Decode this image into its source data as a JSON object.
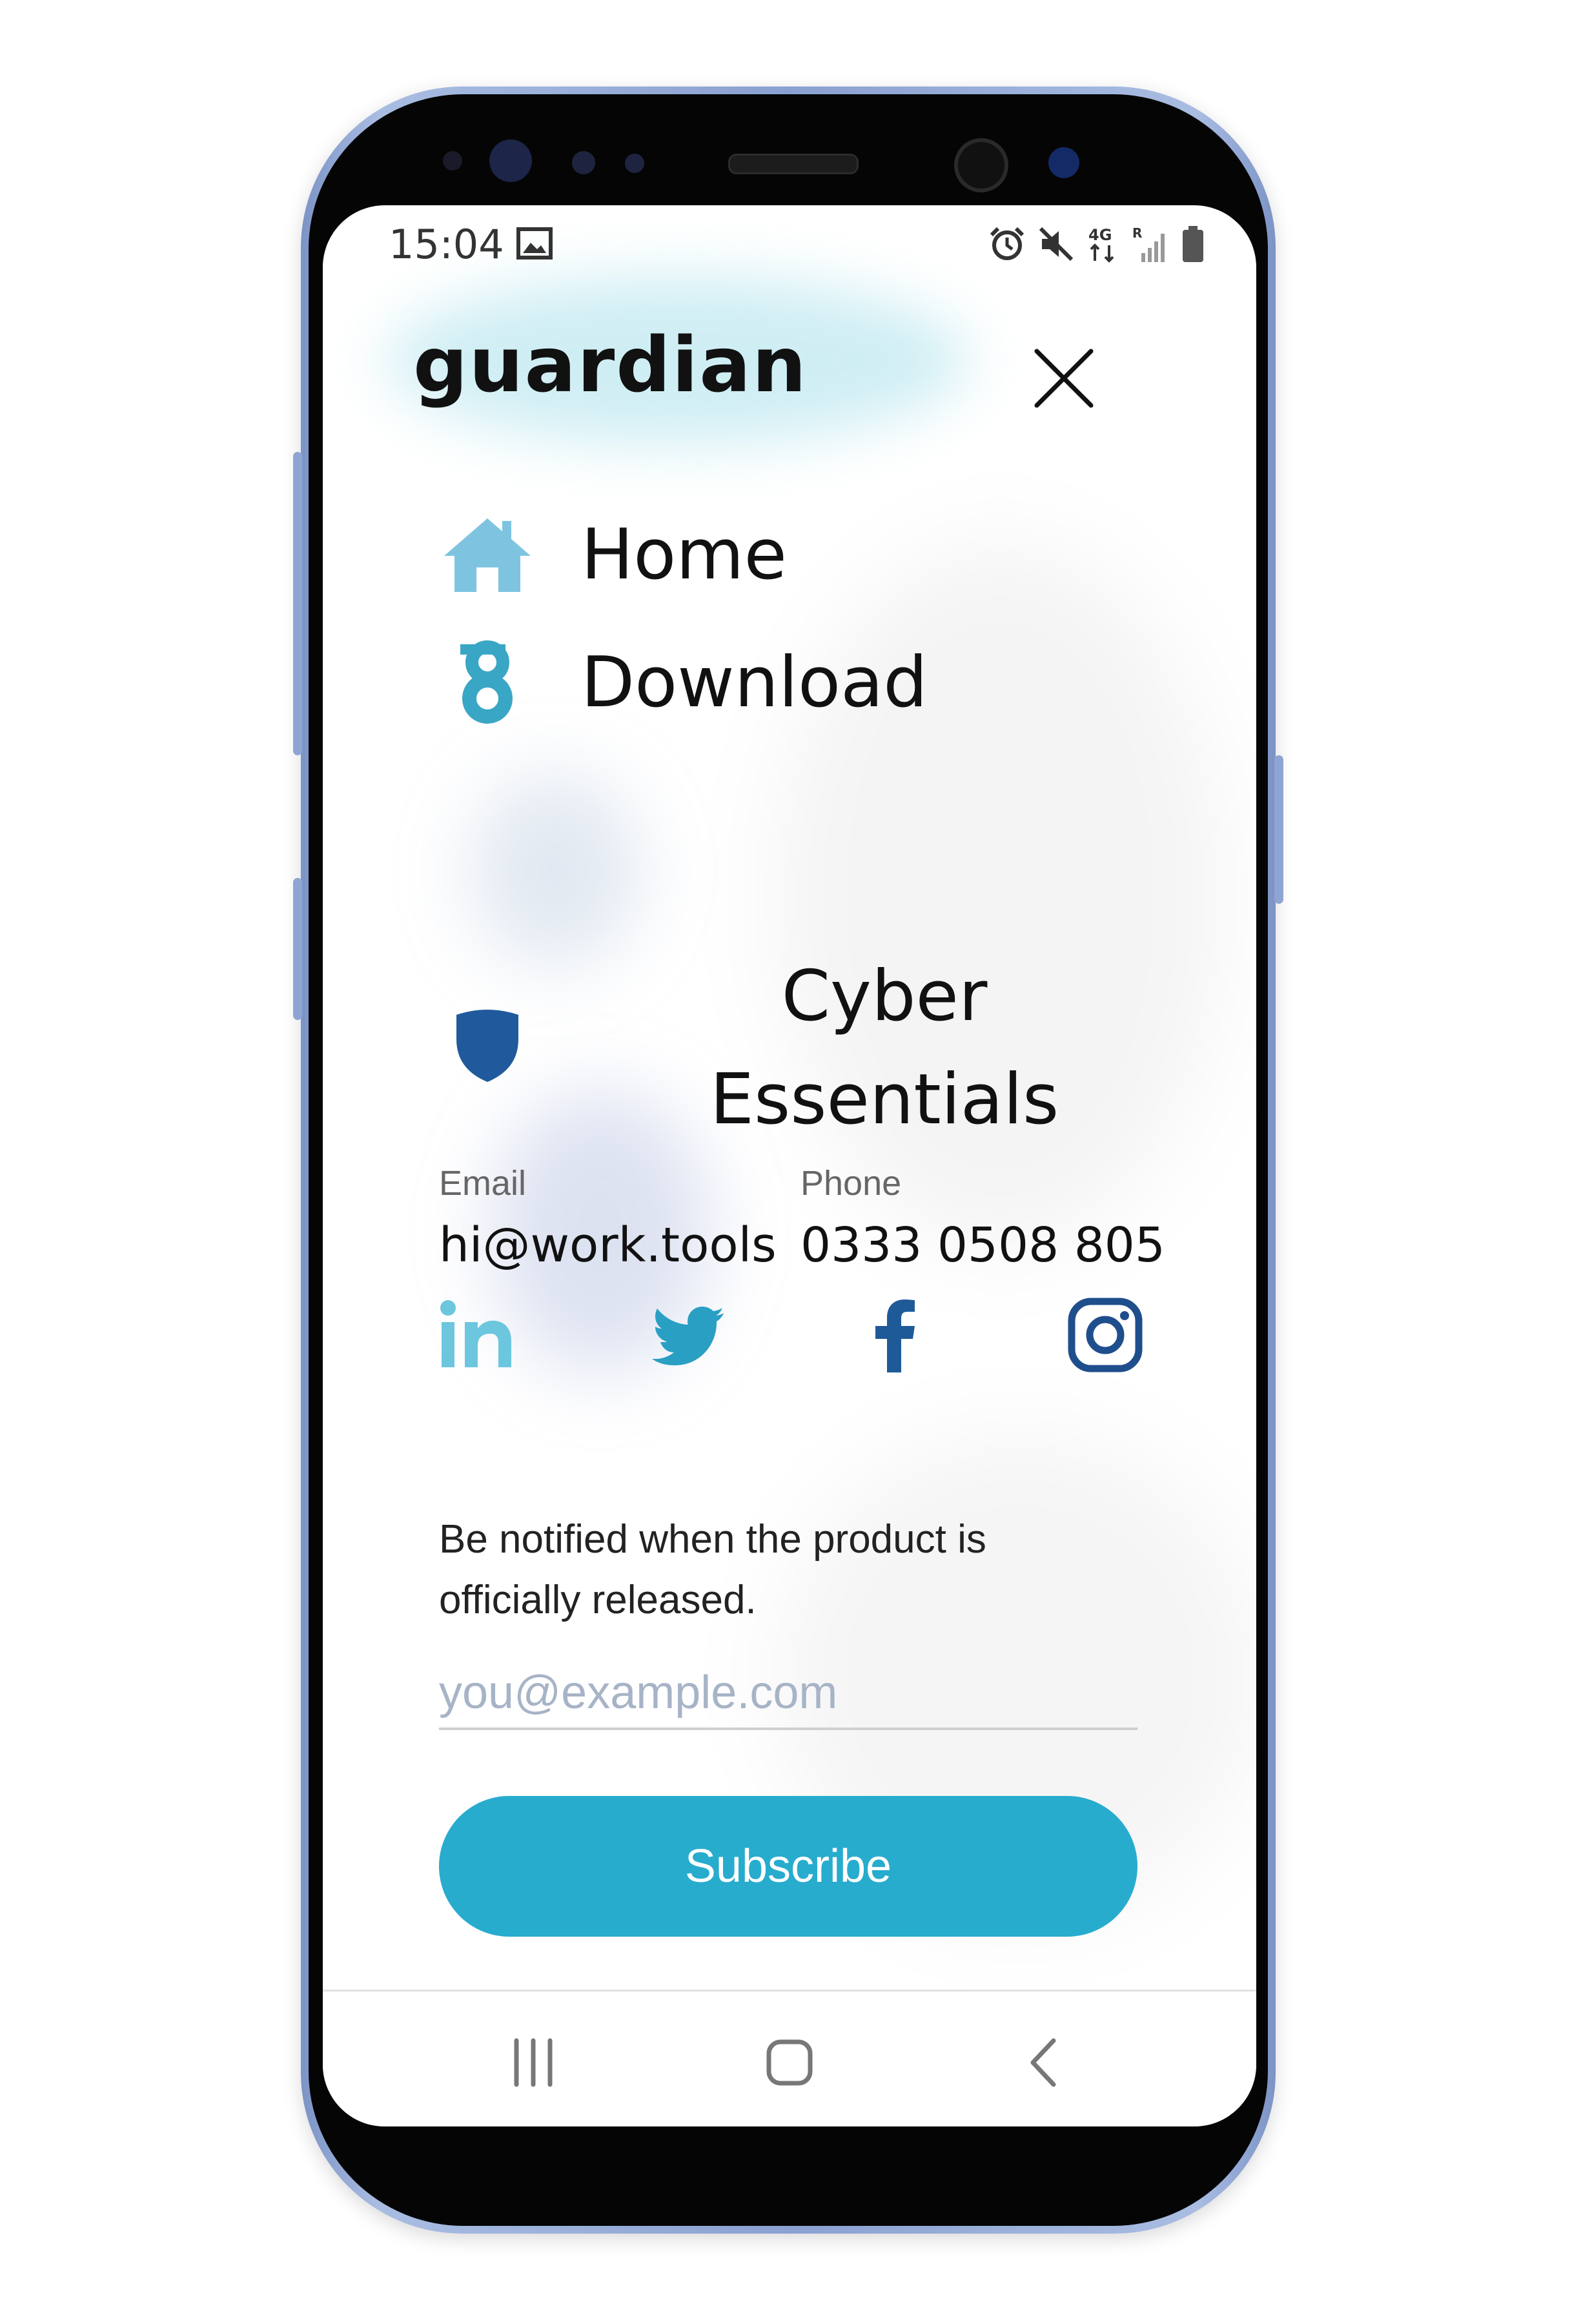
{
  "status_bar": {
    "time": "15:04",
    "icons": [
      "gallery-icon",
      "alarm-icon",
      "mute-icon",
      "4g-data-icon",
      "signal-icon",
      "battery-icon"
    ]
  },
  "header": {
    "logo_text": "guardian",
    "close_icon": "close-icon"
  },
  "menu": {
    "items": [
      {
        "label": "Home",
        "icon": "home-icon"
      },
      {
        "label": "Download",
        "icon": "guardian-g-icon"
      },
      {
        "label_line1": "Cyber",
        "label_line2": "Essentials",
        "icon": "shield-icon"
      }
    ]
  },
  "contact": {
    "email_label": "Email",
    "email_value": "hi@work.tools",
    "phone_label": "Phone",
    "phone_value": "0333 0508 805"
  },
  "social": [
    "linkedin-icon",
    "twitter-icon",
    "facebook-icon",
    "instagram-icon"
  ],
  "newsletter": {
    "text": "Be notified when the product is officially released.",
    "placeholder": "you@example.com",
    "button_label": "Subscribe"
  },
  "nav_bar": [
    "recent-apps-icon",
    "home-nav-icon",
    "back-icon"
  ],
  "colors": {
    "accent": "#27acce",
    "home_icon": "#7ec4e0",
    "shield": "#215a9c",
    "facebook": "#1f5a98",
    "instagram": "#1f4e8c"
  }
}
